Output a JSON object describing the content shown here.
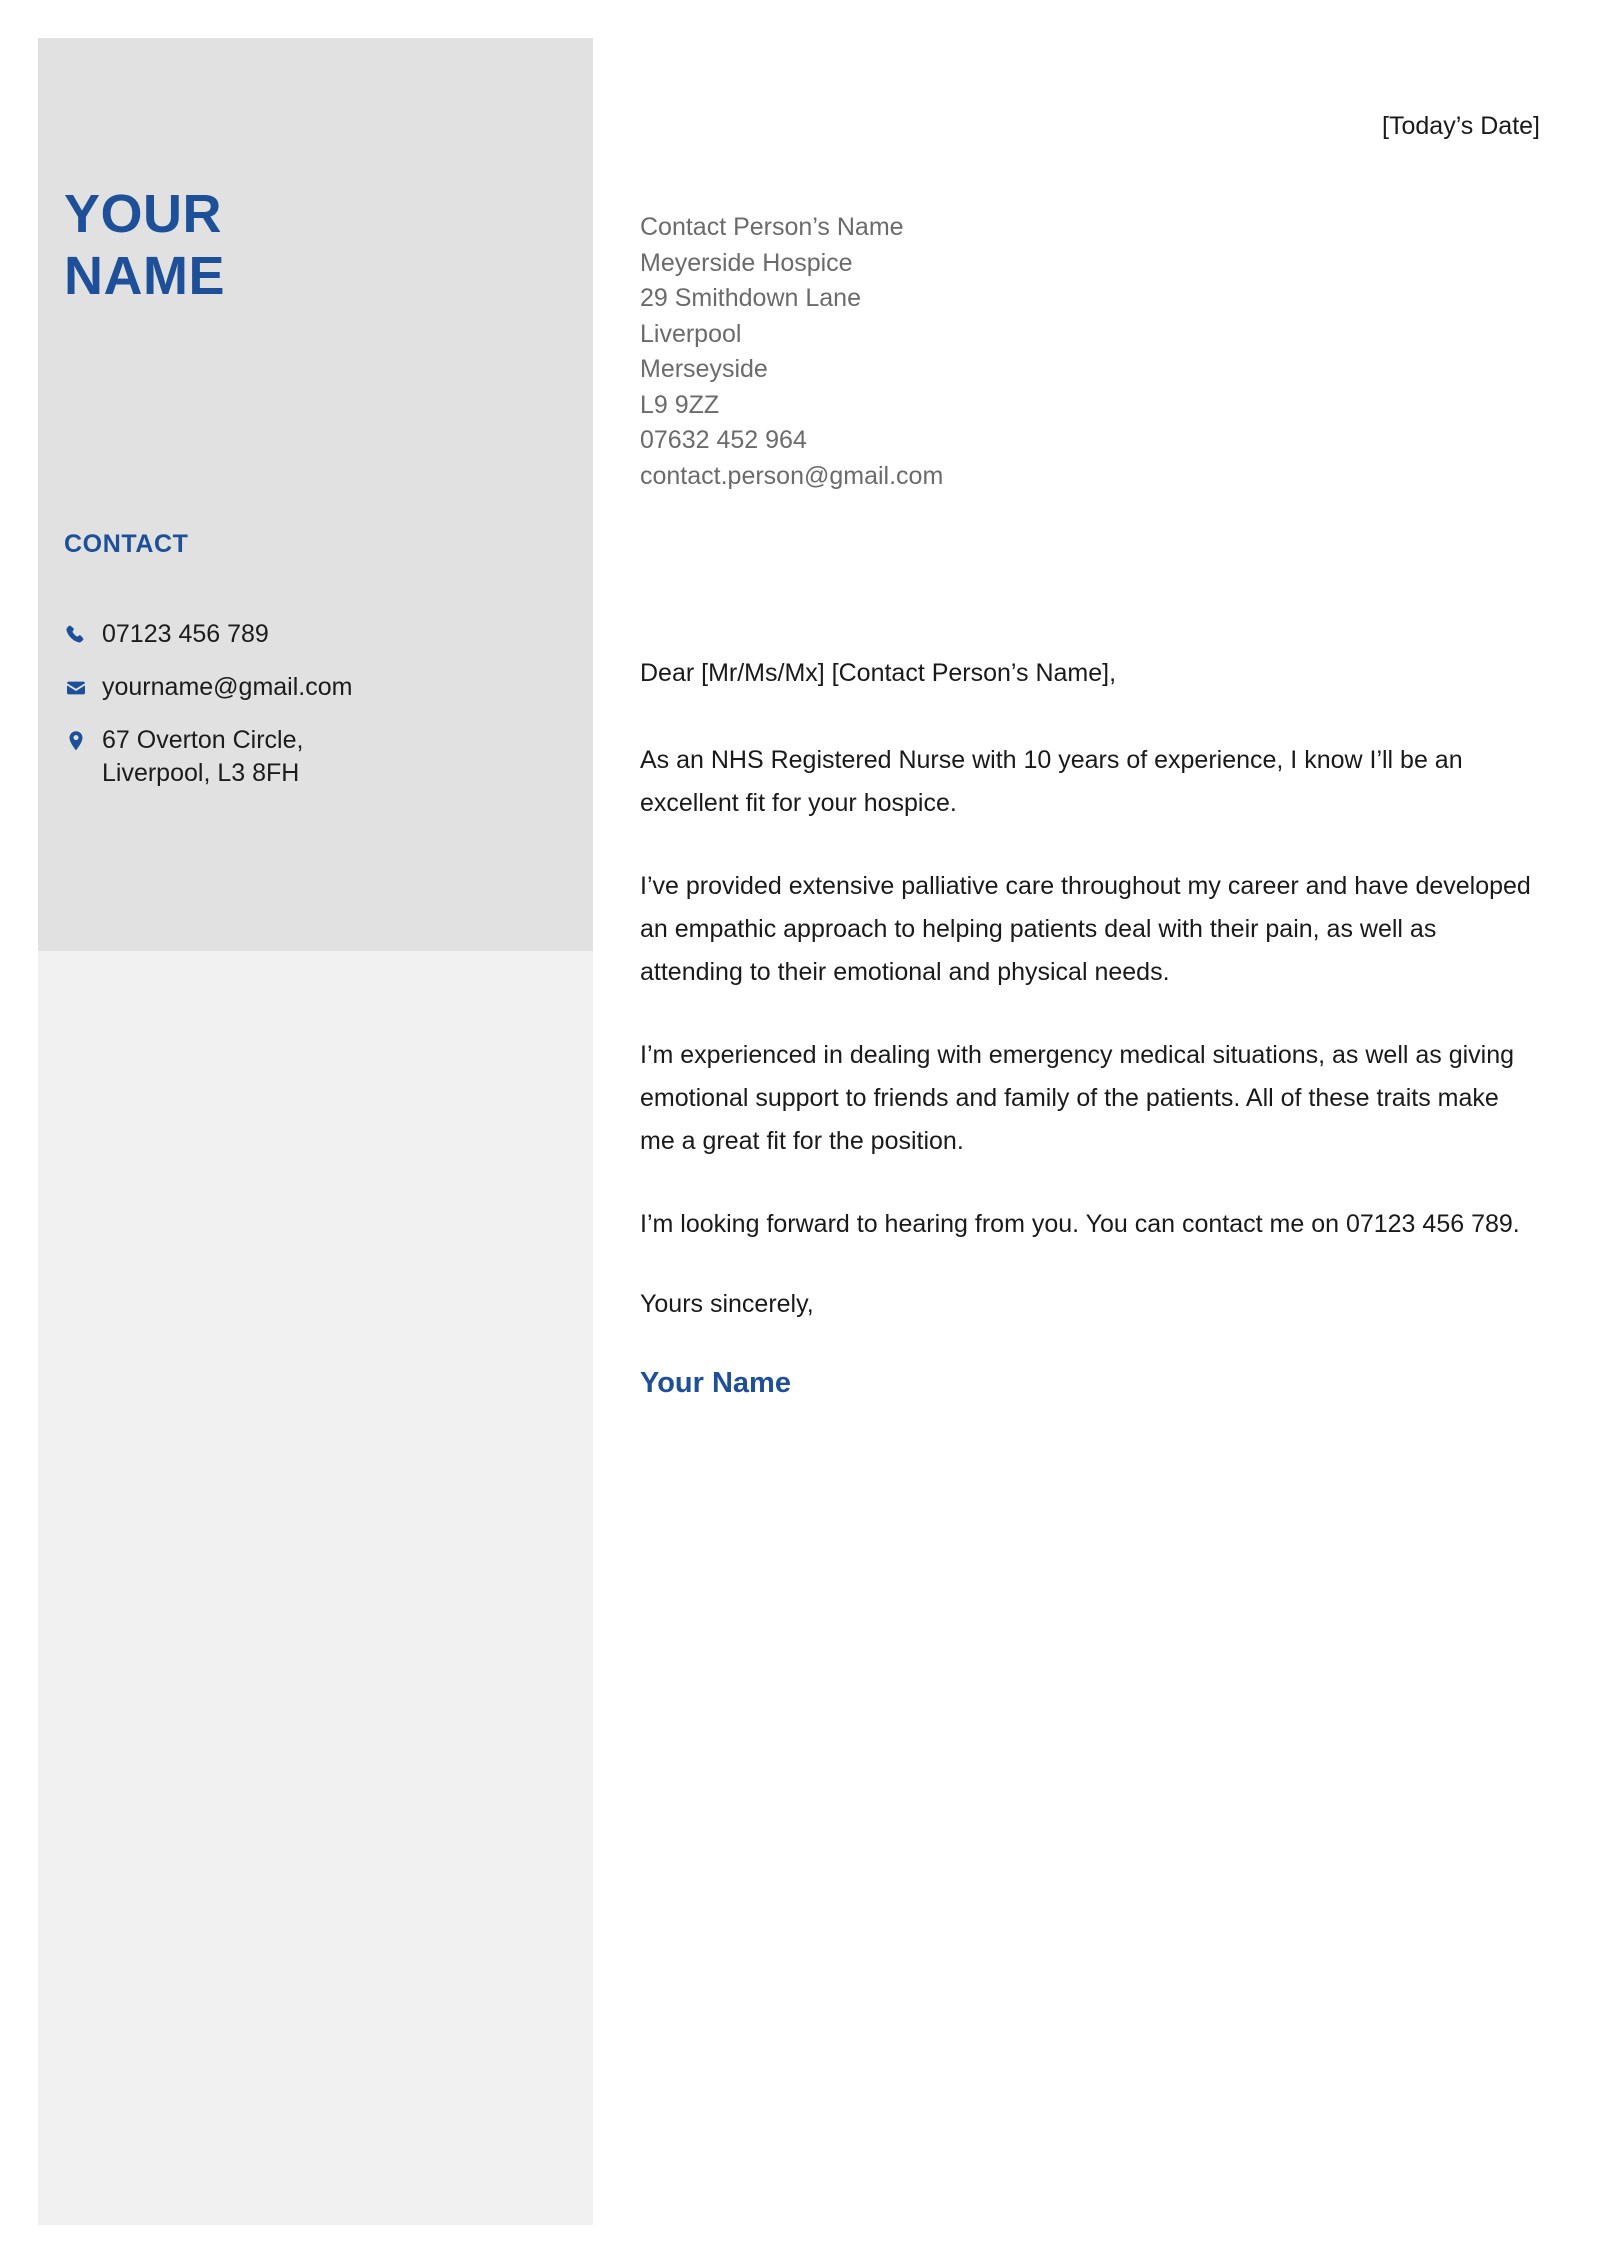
{
  "theme": {
    "accent_color": "#1d5099",
    "sidebar_top_color": "#e1e1e1",
    "sidebar_bottom_color": "#f1f1f1",
    "body_text_color": "#1a1a1a",
    "recipient_text_color": "#6b6b6b",
    "page_background": "#ffffff"
  },
  "sidebar": {
    "name": {
      "line1": "YOUR",
      "line2": "NAME"
    },
    "contact_heading": "CONTACT",
    "contact_items": [
      {
        "icon": "phone-icon",
        "text": "07123 456 789"
      },
      {
        "icon": "envelope-icon",
        "text": "yourname@gmail.com"
      },
      {
        "icon": "location-pin-icon",
        "text": "67 Overton Circle,\nLiverpool, L3 8FH"
      }
    ]
  },
  "letter": {
    "date": "[Today’s Date]",
    "recipient": [
      "Contact Person’s Name",
      "Meyerside Hospice",
      "29 Smithdown Lane",
      "Liverpool",
      "Merseyside",
      "L9 9ZZ",
      "07632 452 964",
      "contact.person@gmail.com"
    ],
    "salutation": "Dear [Mr/Ms/Mx] [Contact Person’s Name],",
    "paragraphs": [
      "As an NHS Registered Nurse with 10 years of experience, I know I’ll be an excellent fit for your hospice.",
      "I’ve provided extensive palliative care throughout my career and have developed an empathic approach to helping patients deal with their pain, as well as attending to their emotional and physical needs.",
      "I’m experienced in dealing with emergency medical situations, as well as giving emotional support to friends and family of the patients. All of these traits make me a great fit for the position.",
      "I’m looking forward to hearing from you. You can contact me on 07123 456 789."
    ],
    "closing": "Yours sincerely,",
    "signature": "Your Name"
  }
}
